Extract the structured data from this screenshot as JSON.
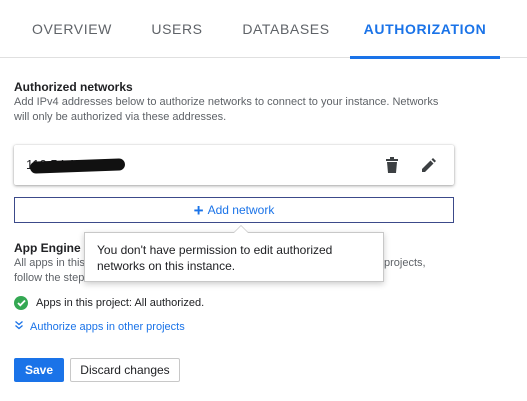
{
  "tabs": [
    {
      "label": "OVERVIEW",
      "active": false
    },
    {
      "label": "USERS",
      "active": false
    },
    {
      "label": "DATABASES",
      "active": false
    },
    {
      "label": "AUTHORIZATION",
      "active": true
    }
  ],
  "authorized_networks": {
    "title": "Authorized networks",
    "description": "Add IPv4 addresses below to authorize networks to connect to your instance. Networks will only be authorized via these addresses.",
    "network_value": "110.54.174.00",
    "delete_icon": "trash-icon",
    "edit_icon": "pencil-icon",
    "add_button_label": "Add network"
  },
  "app_engine": {
    "title": "App Engine au",
    "desc_line1": "All apps in this",
    "desc_line1_right": "projects,",
    "desc_line2": "follow the step",
    "status_text": "Apps in this project: All authorized.",
    "expand_label": "Authorize apps in other projects"
  },
  "tooltip": {
    "text": "You don't have permission to edit authorized networks on this instance."
  },
  "actions": {
    "save_label": "Save",
    "discard_label": "Discard changes"
  },
  "colors": {
    "accent": "#1a73e8",
    "success": "#34a853"
  }
}
